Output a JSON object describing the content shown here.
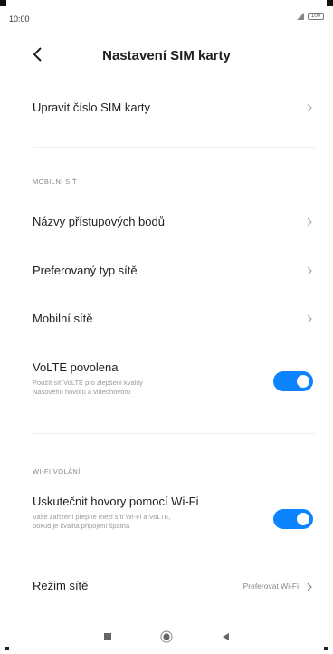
{
  "status_bar": {
    "time": "10:00",
    "signal_label": "",
    "battery_label": "100"
  },
  "header": {
    "title": "Nastavení SIM karty"
  },
  "rows": {
    "edit_sim_number": {
      "label": "Upravit číslo SIM karty"
    },
    "apn": {
      "label": "Názvy přístupových bodů"
    },
    "network_type": {
      "label": "Preferovaný typ sítě"
    },
    "mobile_networks": {
      "label": "Mobilní sítě"
    },
    "volte": {
      "label": "VoLTE povolena",
      "description": "Použít síť VoLTE pro zlepšení kvality\nNasového hovoru a videohovoru",
      "enabled": true
    },
    "wifi_calling": {
      "label": "Uskutečnit hovory pomocí Wi-Fi",
      "description": "Vaše zařízení přepne mezi sítí Wi-Fi a VoLTE,\npokud je kvalita připojení špatná",
      "enabled": true
    },
    "network_mode": {
      "label": "Režim sítě",
      "value": "Preferovat Wi-Fi"
    }
  },
  "sections": {
    "mobile_network": "MOBILNÍ SÍŤ",
    "wifi_calling": "WI-FI VOLÁNÍ"
  },
  "colors": {
    "accent": "#0d84ff",
    "text": "#1f1f1f",
    "secondary": "#9a9a9a"
  },
  "icons": {
    "back": "back-arrow-icon",
    "chevron": "chevron-right-icon",
    "nav_recent": "square-icon",
    "nav_home": "circle-icon",
    "nav_back": "triangle-back-icon"
  }
}
